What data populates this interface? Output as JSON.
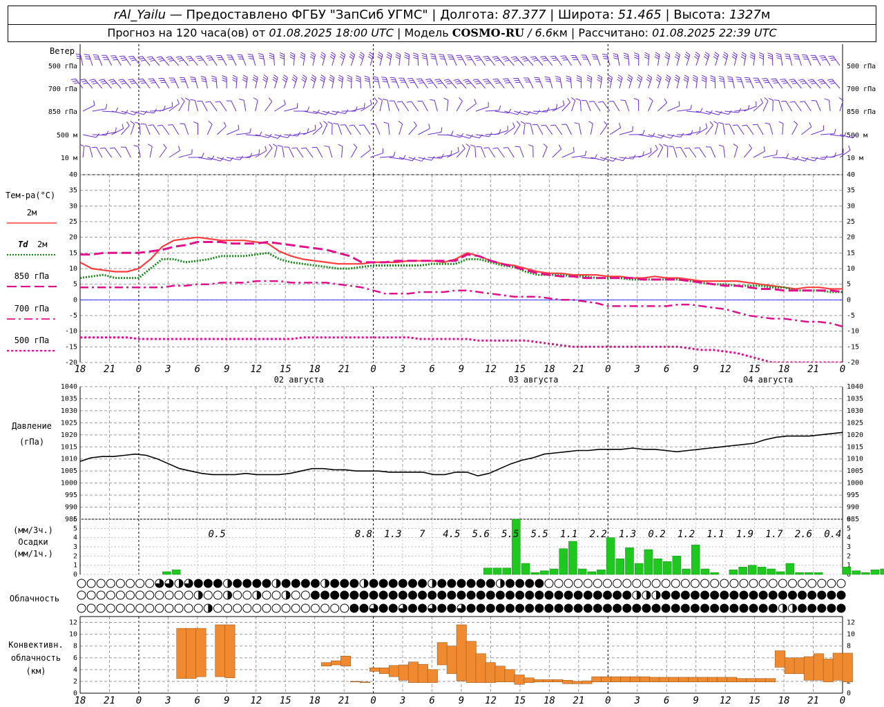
{
  "header": {
    "station": "rAl_Yailu",
    "sep1": " — ",
    "provider": "Предоставлено ФГБУ \"ЗапСиб УГМС\"",
    "lon_label": " | Долгота: ",
    "lon": "87.377",
    "lat_label": " | Широта: ",
    "lat": "51.465",
    "alt_label": " | Высота: ",
    "alt": "1327",
    "alt_unit": "м",
    "forecast_label": "Прогноз на 120 часа(ов) от ",
    "forecast_time": "01.08.2025 18:00 UTC",
    "model_label": "  | Модель ",
    "model": "COSMO-RU",
    "model_sep": " / ",
    "model_res": "6.6",
    "model_res_unit": "км",
    "calc_label": " | Рассчитано: ",
    "calc_time": "01.08.2025 22:39 UTC"
  },
  "chart_data": [
    {
      "type": "wind-barbs",
      "title": "Ветер",
      "levels": [
        "500 гПа",
        "700 гПа",
        "850 гПа",
        "500 м",
        "10  м"
      ]
    },
    {
      "type": "line",
      "title": "Тем-ра(°C)",
      "x_ticks": [
        "18",
        "21",
        "0",
        "3",
        "6",
        "9",
        "12",
        "15",
        "18",
        "21",
        "0",
        "3",
        "6",
        "9",
        "12",
        "15",
        "18",
        "21",
        "0",
        "3",
        "6",
        "9",
        "12",
        "15",
        "18",
        "21",
        "0"
      ],
      "date_labels": [
        "02 августа",
        "03 августа",
        "04 августа"
      ],
      "ylim": [
        -20,
        40
      ],
      "y_ticks": [
        -20,
        -15,
        -10,
        -5,
        0,
        5,
        10,
        15,
        20,
        25,
        30,
        35,
        40
      ],
      "series": [
        {
          "name": "2м",
          "color": "#ff3c3c",
          "style": "solid",
          "values": [
            12,
            10,
            9.5,
            9,
            9,
            10,
            13,
            17,
            19,
            19.5,
            20,
            19.5,
            19,
            19,
            19,
            18.5,
            18,
            15.5,
            14,
            13,
            12.5,
            12,
            11.5,
            11.5,
            11.5,
            12,
            12,
            12,
            12.5,
            12.5,
            12.5,
            12,
            13,
            15,
            14,
            12.5,
            11.5,
            11,
            10,
            9,
            8.5,
            8.5,
            8,
            8,
            8,
            7.5,
            7.5,
            7,
            7,
            7.5,
            7,
            7,
            6.5,
            6,
            6,
            6,
            6,
            5.5,
            5,
            4.5,
            4,
            3.5,
            4,
            4,
            3.5,
            3.5
          ]
        },
        {
          "name": "Td",
          "label_suffix": "2м",
          "color": "#138a13",
          "style": "dotted",
          "values": [
            7,
            7.5,
            8,
            7,
            7,
            7,
            10,
            13,
            13,
            12,
            12.5,
            13,
            14,
            14,
            14,
            14.5,
            15,
            13,
            12,
            11.5,
            11,
            10.5,
            10,
            10,
            10.5,
            11,
            11,
            11,
            11,
            11,
            11.5,
            11.5,
            11.5,
            13,
            13,
            12,
            11,
            10.5,
            9,
            8,
            8,
            8,
            7.5,
            7.5,
            7,
            7,
            7,
            6.5,
            6.5,
            6.5,
            6.5,
            6.5,
            6,
            5.5,
            5,
            5,
            4.5,
            4.5,
            4.5,
            4,
            4,
            3,
            3,
            3,
            2.5,
            2.5
          ]
        },
        {
          "name": "850 гПа",
          "color": "#e0108c",
          "style": "long-dash",
          "values": [
            14.5,
            14.5,
            15,
            15,
            15,
            15,
            15.5,
            16,
            17,
            17.5,
            18.5,
            18.5,
            18.5,
            18,
            18,
            18,
            18.5,
            18,
            17.5,
            17,
            16.5,
            16,
            15,
            14,
            12,
            12,
            12,
            12.5,
            12.5,
            12.5,
            12.5,
            12.5,
            12.5,
            14.5,
            14,
            12.5,
            11.5,
            10.5,
            9.5,
            8.5,
            8,
            7.5,
            7.5,
            7,
            7,
            7,
            7,
            7,
            6.5,
            6.5,
            6.5,
            6.5,
            6,
            5.5,
            5,
            4.5,
            4.5,
            4,
            3.5,
            3.5,
            3,
            3,
            3,
            3,
            3,
            2.5
          ]
        },
        {
          "name": "700 гПа",
          "color": "#e0108c",
          "style": "dash-dot",
          "values": [
            4,
            4,
            4,
            4,
            4,
            4,
            4,
            4,
            4.5,
            4.5,
            5,
            5,
            5.5,
            5.5,
            5.5,
            6,
            6,
            6,
            5.5,
            5.5,
            5.5,
            5.5,
            5,
            4.5,
            4,
            3,
            2,
            2,
            2,
            2.5,
            2.5,
            2.5,
            3,
            3,
            2.5,
            2,
            1.5,
            1,
            1,
            1,
            0.5,
            0,
            0,
            -0.5,
            -1,
            -2,
            -2,
            -2,
            -2,
            -2,
            -2,
            -1.5,
            -1.5,
            -2,
            -2.5,
            -3,
            -4,
            -5,
            -5.5,
            -6,
            -6,
            -6.5,
            -7,
            -7,
            -7.5,
            -8.5
          ]
        },
        {
          "name": "500 гПа",
          "color": "#e0108c",
          "style": "short-dash",
          "values": [
            -12,
            -12,
            -12,
            -12,
            -12,
            -12.5,
            -12.5,
            -12.5,
            -12.5,
            -12.5,
            -12.5,
            -12.5,
            -12.5,
            -12.5,
            -12.5,
            -12.5,
            -12.5,
            -12.5,
            -12.5,
            -12,
            -12,
            -12,
            -12,
            -12,
            -12,
            -12,
            -12,
            -12,
            -12,
            -12.5,
            -12.5,
            -12.5,
            -12.5,
            -12.5,
            -13,
            -13,
            -13,
            -13,
            -13,
            -13.5,
            -14,
            -14.5,
            -15,
            -15,
            -15,
            -15,
            -15,
            -15,
            -15,
            -15,
            -15,
            -15,
            -15.5,
            -16,
            -16,
            -16.5,
            -17,
            -18,
            -19,
            -20,
            -21,
            -22,
            -23,
            -24,
            -25,
            -26
          ]
        }
      ]
    },
    {
      "type": "line",
      "title": "Давление",
      "ylabel": "(гПа)",
      "ylim": [
        985,
        1040
      ],
      "y_ticks": [
        985,
        990,
        995,
        1000,
        1005,
        1010,
        1015,
        1020,
        1025,
        1030,
        1035,
        1040
      ],
      "series": [
        {
          "name": "",
          "color": "#000000",
          "values": [
            1009,
            1010.5,
            1011,
            1011,
            1011.5,
            1012,
            1011.5,
            1010,
            1008,
            1006,
            1005,
            1004,
            1003.5,
            1003.5,
            1003.5,
            1004,
            1003.5,
            1003.5,
            1003.5,
            1004,
            1005,
            1006,
            1006,
            1005.5,
            1005.5,
            1005,
            1005,
            1005,
            1004.5,
            1004.5,
            1004.5,
            1004.5,
            1003.5,
            1003.5,
            1004.5,
            1004.5,
            1003,
            1004,
            1006,
            1008,
            1009.5,
            1010.5,
            1012,
            1012.5,
            1013,
            1013.5,
            1013.5,
            1014,
            1014,
            1014,
            1014.5,
            1014,
            1014,
            1013.5,
            1013,
            1013.5,
            1014,
            1014.5,
            1015,
            1015.5,
            1016,
            1016.5,
            1018,
            1019,
            1019.5,
            1019.5,
            1019.5,
            1020,
            1020.5,
            1021
          ]
        }
      ]
    },
    {
      "type": "bar",
      "title": "Осадки",
      "ylabel_top": "(мм/3ч.)",
      "ylabel_bottom": "(мм/1ч.)",
      "ylim": [
        0,
        6
      ],
      "y_ticks": [
        0,
        1,
        2,
        3,
        4,
        5,
        6
      ],
      "color": "#1ec81e",
      "values": [
        0,
        0,
        0,
        0,
        0,
        0,
        0,
        0,
        0,
        0,
        0,
        0,
        0,
        0,
        0,
        0,
        0,
        0,
        0,
        0,
        0,
        0,
        0,
        0,
        0,
        0,
        0,
        0,
        0,
        0,
        0,
        0,
        0,
        0,
        0,
        0,
        0,
        0,
        0,
        0,
        0,
        0,
        0,
        0,
        0,
        0,
        0,
        0,
        0,
        0,
        0,
        0,
        0,
        0,
        0,
        0,
        0,
        0,
        0,
        0,
        0,
        0,
        0,
        0,
        0,
        0,
        0,
        0,
        0.3,
        0.5,
        0,
        0,
        0,
        0,
        0,
        0,
        0,
        0,
        0,
        0,
        0,
        0,
        0,
        0,
        0,
        0,
        0,
        0,
        0,
        0,
        0,
        0,
        0,
        0,
        0,
        0,
        0,
        0,
        0,
        0,
        0,
        0,
        0.7,
        0.7,
        0.7,
        6,
        1.2,
        0.2,
        0.4,
        0.6,
        2.8,
        3.6,
        0.6,
        0.3,
        0.5,
        4,
        1.7,
        2.9,
        1.2,
        2.7,
        1.7,
        1.4,
        2,
        0.6,
        3.2,
        0.6,
        0.2,
        0,
        0.5,
        0.8,
        1,
        0.8,
        0.6,
        0.3,
        1.2,
        0.2,
        0.2,
        0.2,
        0,
        0,
        0.8,
        0.4,
        0.2,
        0.5,
        0.6,
        0,
        1.1,
        0.8,
        0.5,
        1.4,
        0.6,
        0,
        0,
        0,
        0.2,
        2.6,
        0.2,
        0,
        0,
        0.4
      ],
      "totals": [
        {
          "label": "0.5",
          "x": 14
        },
        {
          "label": "8.8",
          "x": 29
        },
        {
          "label": "1.3",
          "x": 32
        },
        {
          "label": "7",
          "x": 35
        },
        {
          "label": "4.5",
          "x": 38
        },
        {
          "label": "5.6",
          "x": 41
        },
        {
          "label": "5.5",
          "x": 44
        },
        {
          "label": "5.5",
          "x": 47
        },
        {
          "label": "1.1",
          "x": 50
        },
        {
          "label": "2.2",
          "x": 53
        },
        {
          "label": "1.3",
          "x": 56
        },
        {
          "label": "0.2",
          "x": 59
        },
        {
          "label": "1.2",
          "x": 62
        },
        {
          "label": "1.1",
          "x": 65
        },
        {
          "label": "1.9",
          "x": 68
        },
        {
          "label": "1.7",
          "x": 71
        },
        {
          "label": "2.6",
          "x": 74
        },
        {
          "label": "0.4",
          "x": 77
        }
      ]
    },
    {
      "type": "symbols",
      "title": "Облачность"
    },
    {
      "type": "bar",
      "title": "Конвективн.",
      "title2": "облачность",
      "ylabel": "(км)",
      "ylim": [
        0,
        13
      ],
      "y_ticks": [
        0,
        2,
        4,
        6,
        8,
        10,
        12
      ],
      "color": "#f08a30",
      "ranges": [
        [
          10,
          2.5,
          11
        ],
        [
          11,
          2.5,
          11
        ],
        [
          12,
          2.8,
          11
        ],
        [
          14,
          2.8,
          11.6
        ],
        [
          15,
          2.6,
          11.6
        ],
        [
          25,
          4.6,
          5.2
        ],
        [
          26,
          4.8,
          5.5
        ],
        [
          27,
          4.6,
          6.3
        ],
        [
          28,
          1.9,
          2
        ],
        [
          29,
          1.8,
          1.9
        ],
        [
          30,
          3.7,
          4.3
        ],
        [
          31,
          3.3,
          4.3
        ],
        [
          32,
          2.8,
          4.7
        ],
        [
          33,
          2.2,
          4.8
        ],
        [
          34,
          1.8,
          5.3
        ],
        [
          35,
          1.8,
          4.9
        ],
        [
          36,
          1.8,
          4
        ],
        [
          37,
          4.8,
          8.6
        ],
        [
          38,
          3.3,
          8
        ],
        [
          39,
          2.1,
          11.6
        ],
        [
          40,
          1.8,
          8.8
        ],
        [
          41,
          1.8,
          6.7
        ],
        [
          42,
          1.8,
          5.2
        ],
        [
          43,
          1.9,
          4.6
        ],
        [
          44,
          1.9,
          4
        ],
        [
          45,
          1.5,
          3.1
        ],
        [
          46,
          1.8,
          2.6
        ],
        [
          47,
          1.9,
          2.3
        ],
        [
          48,
          1.9,
          2.3
        ],
        [
          49,
          1.9,
          2.3
        ],
        [
          50,
          1.6,
          2.2
        ],
        [
          51,
          1.6,
          2
        ],
        [
          52,
          1.6,
          2.1
        ],
        [
          53,
          1.9,
          2.8
        ],
        [
          54,
          1.9,
          2.8
        ],
        [
          55,
          1.9,
          2.8
        ],
        [
          56,
          1.9,
          2.8
        ],
        [
          57,
          1.9,
          2.8
        ],
        [
          58,
          1.9,
          2.8
        ],
        [
          59,
          1.9,
          2.7
        ],
        [
          60,
          1.9,
          2.7
        ],
        [
          61,
          1.9,
          2.7
        ],
        [
          62,
          1.9,
          2.7
        ],
        [
          63,
          1.9,
          2.7
        ],
        [
          64,
          1.9,
          2.7
        ],
        [
          65,
          1.9,
          2.7
        ],
        [
          66,
          1.9,
          2.7
        ],
        [
          67,
          1.9,
          2.7
        ],
        [
          68,
          1.9,
          2.5
        ],
        [
          69,
          1.9,
          2.5
        ],
        [
          70,
          1.9,
          2.5
        ],
        [
          71,
          1.9,
          2.5
        ],
        [
          72,
          4.4,
          7.2
        ],
        [
          73,
          3.3,
          6
        ],
        [
          74,
          3.3,
          6
        ],
        [
          75,
          2.2,
          6.2
        ],
        [
          76,
          2.2,
          6.7
        ],
        [
          77,
          1.9,
          5.8
        ],
        [
          78,
          2.2,
          6.8
        ],
        [
          79,
          1.9,
          6.8
        ]
      ]
    }
  ]
}
